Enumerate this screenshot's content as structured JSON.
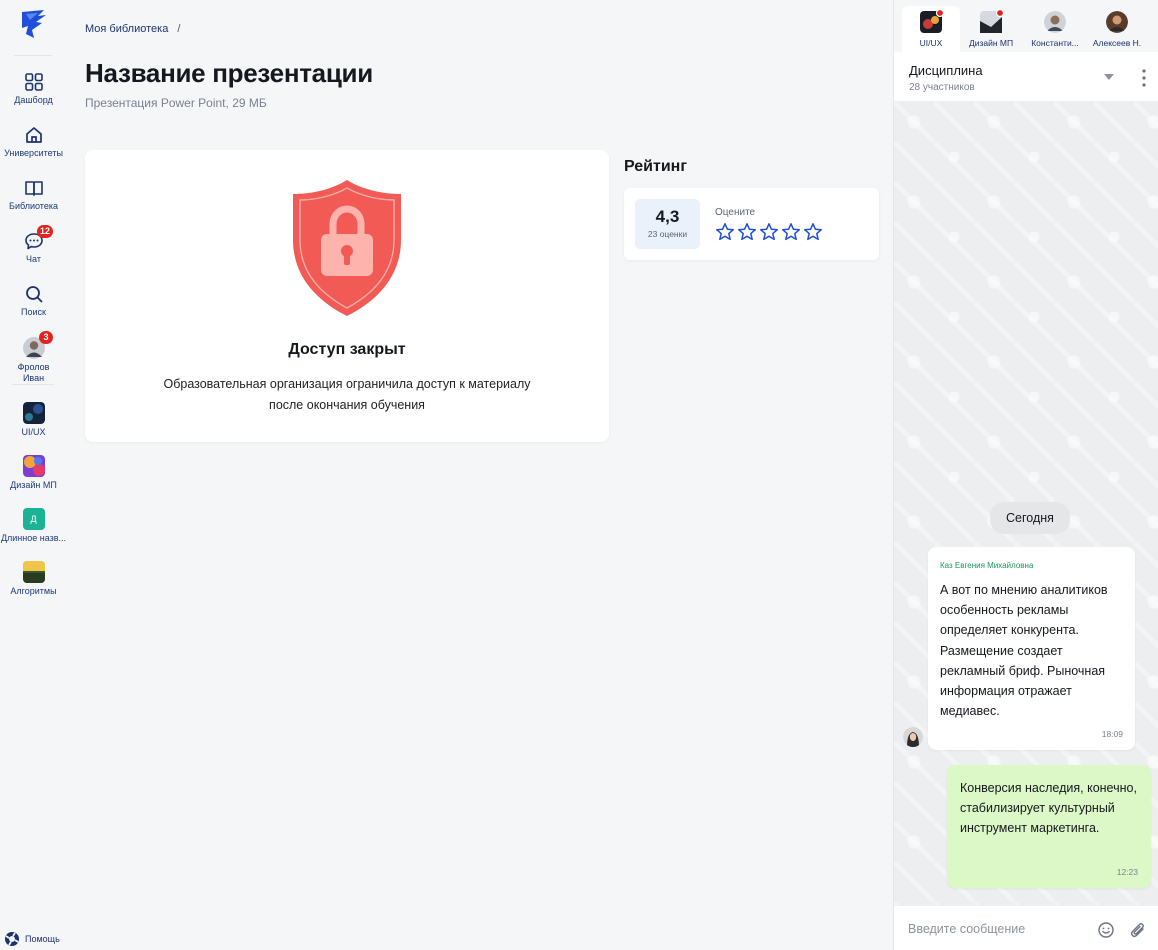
{
  "nav": {
    "items": [
      {
        "label": "Дашборд",
        "icon": "dashboard-icon"
      },
      {
        "label": "Университеты",
        "icon": "home-icon"
      },
      {
        "label": "Библиотека",
        "icon": "book-icon"
      },
      {
        "label": "Чат",
        "icon": "chat-icon",
        "badge": "12"
      },
      {
        "label": "Поиск",
        "icon": "search-icon"
      }
    ],
    "user": {
      "label": "Фролов Иван",
      "badge": "3"
    },
    "courses": [
      {
        "label": "UI/UX"
      },
      {
        "label": "Дизайн МП"
      },
      {
        "label": "Длинное назв...",
        "initial": "Д"
      },
      {
        "label": "Алгоритмы"
      }
    ],
    "help_label": "Помощь"
  },
  "breadcrumb": {
    "item": "Моя библиотека",
    "sep": "/"
  },
  "page": {
    "title": "Название презентации",
    "subtitle": "Презентация Power Point, 29 МБ"
  },
  "access": {
    "title": "Доступ закрыт",
    "text": "Образовательная организация ограничила доступ к материалу после окончания обучения"
  },
  "rating": {
    "title": "Рейтинг",
    "value": "4,3",
    "count": "23 оценки",
    "rate_label": "Оцените",
    "stars_total": 5,
    "stars_filled": 0
  },
  "chat": {
    "tabs": [
      {
        "label": "UI/UX",
        "active": true,
        "dot": true
      },
      {
        "label": "Дизайн МП",
        "dot": true
      },
      {
        "label": "Константи..."
      },
      {
        "label": "Алексеев Н."
      }
    ],
    "header": {
      "title": "Дисциплина",
      "subtitle": "28 участников"
    },
    "day": "Сегодня",
    "messages": [
      {
        "author": "Каз Евгения Михайловна",
        "text": "А вот по мнению аналитиков особенность рекламы определяет конкурента. Размещение создает рекламный бриф. Рыночная информация отражает медиавес.",
        "time": "18:09"
      },
      {
        "text": "Конверсия наследия, конечно, стабилизирует культурный инструмент маркетинга.",
        "time": "12:23"
      }
    ],
    "composer_placeholder": "Введите сообщение"
  },
  "colors": {
    "accent": "#1d3270",
    "star": "#1f4fd8",
    "badge": "#e42321",
    "shield": "#f25a55",
    "outgoing_bubble": "#dcf8c6",
    "author_name": "#1a9b57"
  }
}
